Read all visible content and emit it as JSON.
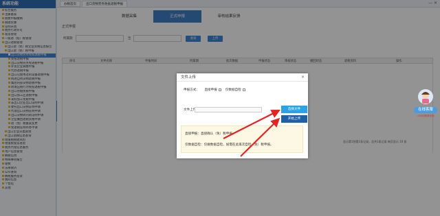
{
  "sidebar": {
    "title": "系统功能",
    "items": [
      {
        "label": "综合服务",
        "level": 0
      },
      {
        "label": "注册备案",
        "level": 0
      },
      {
        "label": "税费申报缴纳",
        "level": 0
      },
      {
        "label": "税收优惠",
        "level": 0
      },
      {
        "label": "证明开具",
        "level": 0
      },
      {
        "label": "税务行政许可",
        "level": 0
      },
      {
        "label": "发票管理",
        "level": 0
      },
      {
        "label": "一般退（抵）税管理",
        "level": 0
      },
      {
        "label": "出口退税管理",
        "level": 0
      },
      {
        "label": "出口退（免）税企业资格信息报告",
        "level": 1
      },
      {
        "label": "出口退（免）税申报",
        "level": 1
      },
      {
        "label": "出口货物劳务免抵退税申报",
        "level": 2,
        "active": true
      },
      {
        "label": "免抵退税申报",
        "level": 2
      },
      {
        "label": "出口货物劳务免退税申报",
        "level": 2
      },
      {
        "label": "外贸企业调整申报",
        "level": 2
      },
      {
        "label": "代办退税申报",
        "level": 2
      },
      {
        "label": "出口已使用过的设备退税申报",
        "level": 2
      },
      {
        "label": "购进自用货物退税申报",
        "level": 2
      },
      {
        "label": "集团内部货物退税申报",
        "level": 2
      },
      {
        "label": "跨境应税行为免抵退税申报",
        "level": 2
      },
      {
        "label": "出口卷烟免税申报",
        "level": 2
      },
      {
        "label": "出口加工区退税申报",
        "level": 2
      },
      {
        "label": "来料加工免税申报",
        "level": 2
      },
      {
        "label": "非出口企业出口证明申请",
        "level": 2
      },
      {
        "label": "委托出口货物证明申请",
        "level": 2
      },
      {
        "label": "代理出口货物证明申请",
        "level": 2
      },
      {
        "label": "出口货物转内销证明申请",
        "level": 2
      },
      {
        "label": "企业撤回退税资格申请",
        "level": 2
      },
      {
        "label": "退（免）税备案变更",
        "level": 2
      },
      {
        "label": "免退税证明补办申请",
        "level": 2
      },
      {
        "label": "出口企业分类管理",
        "level": 1
      },
      {
        "label": "出口退税信息查询",
        "level": 1
      },
      {
        "label": "增值税税收风险",
        "level": 0
      },
      {
        "label": "增值税发票查验",
        "level": 0
      },
      {
        "label": "税务代理信息服务",
        "level": 0
      },
      {
        "label": "用户信息管理",
        "level": 0
      },
      {
        "label": "纳税信用",
        "level": 0
      },
      {
        "label": "特殊事项报告",
        "level": 0
      },
      {
        "label": "收费",
        "level": 0
      },
      {
        "label": "法律救济",
        "level": 0
      },
      {
        "label": "公众查询",
        "level": 0
      },
      {
        "label": "纳税服务投诉",
        "level": 0
      },
      {
        "label": "我的信息",
        "level": 0
      },
      {
        "label": "个性化",
        "level": 0
      },
      {
        "label": "其他",
        "level": 0
      }
    ]
  },
  "topbar": {
    "tabs": [
      "办税首页",
      "出口货物劳务免抵退税申报"
    ],
    "window_buttons": "— ✕"
  },
  "nav_tabs": [
    {
      "label": "数据采集",
      "active": false
    },
    {
      "label": "正式申报",
      "active": true
    },
    {
      "label": "审核结果反馈",
      "active": false
    }
  ],
  "section_label": "正式申报",
  "filter": {
    "label1": "所属期",
    "label2": "至",
    "query_button": "查询",
    "upload_button": "上传"
  },
  "table": {
    "columns": [
      "序号",
      "文件名称",
      "申报时间",
      "所属期",
      "批次数据",
      "申报状态",
      "审核状态",
      "撤回状态",
      "退税资料",
      "操作"
    ]
  },
  "pager": {
    "text": "显示第1到第1条记录，总共1条记录  每页显示 10 条"
  },
  "modal": {
    "title": "文件上传",
    "close": "×",
    "mode_label": "申报方式：",
    "option1": "直接申报",
    "option2": "仅数据自检",
    "file_label": "文件上传：",
    "select_button": "选择文件",
    "upload_button": "开始上传",
    "note1": "直接申报：直接确认（免）税申报。",
    "note2": "仅数据自检：仅做数据自检，如需在此再次自检（免）税申报。"
  },
  "service": {
    "label": "在线客服",
    "sub": "小诗问题请咨询"
  },
  "colors": {
    "accent": "#3d86d6",
    "select_button": "#29a3e6",
    "upload_button": "#1f5fa8",
    "arrow": "#e62323"
  }
}
